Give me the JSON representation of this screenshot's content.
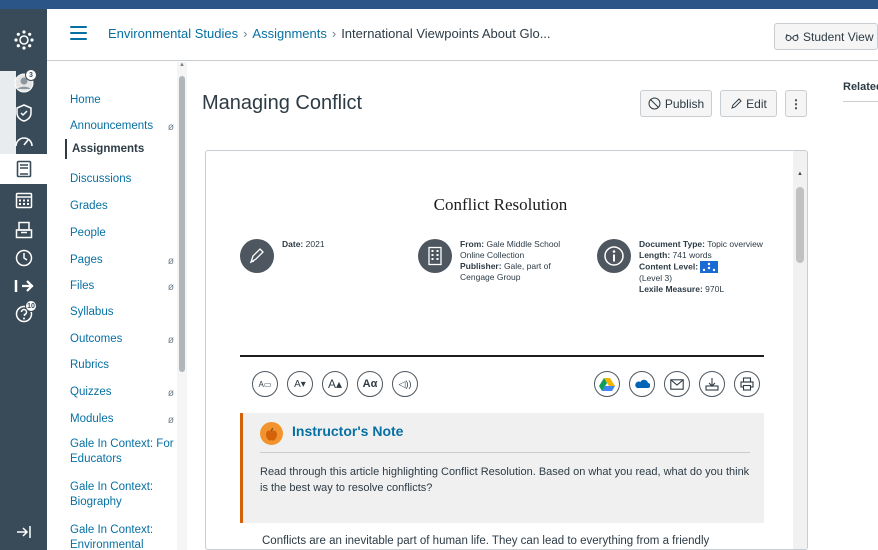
{
  "header": {
    "breadcrumbs": [
      "Environmental Studies",
      "Assignments",
      "International Viewpoints About Glo..."
    ],
    "student_view_label": "Student View"
  },
  "global_nav": {
    "items": [
      {
        "icon": "logo-icon"
      },
      {
        "icon": "account-icon",
        "badge": "3"
      },
      {
        "icon": "admin-icon"
      },
      {
        "icon": "dashboard-icon"
      },
      {
        "icon": "courses-icon",
        "active": true
      },
      {
        "icon": "calendar-icon"
      },
      {
        "icon": "inbox-icon"
      },
      {
        "icon": "history-icon"
      },
      {
        "icon": "commons-icon"
      },
      {
        "icon": "help-icon",
        "badge": "10"
      },
      {
        "icon": "collapse-icon"
      }
    ]
  },
  "course_nav": {
    "items": [
      {
        "label": "Home",
        "hidden": false
      },
      {
        "label": "Announcements",
        "hidden": true
      },
      {
        "label": "Assignments",
        "hidden": false,
        "active": true
      },
      {
        "label": "Discussions",
        "hidden": false
      },
      {
        "label": "Grades",
        "hidden": false
      },
      {
        "label": "People",
        "hidden": false
      },
      {
        "label": "Pages",
        "hidden": true
      },
      {
        "label": "Files",
        "hidden": true
      },
      {
        "label": "Syllabus",
        "hidden": false
      },
      {
        "label": "Outcomes",
        "hidden": true
      },
      {
        "label": "Rubrics",
        "hidden": false
      },
      {
        "label": "Quizzes",
        "hidden": true
      },
      {
        "label": "Modules",
        "hidden": true
      },
      {
        "label": "Gale In Context: For Educators",
        "hidden": false
      },
      {
        "label": "Gale In Context: Biography",
        "hidden": false
      },
      {
        "label": "Gale In Context: Environmental Studies",
        "hidden": false
      }
    ]
  },
  "page": {
    "title": "Managing Conflict",
    "publish_label": "Publish",
    "edit_label": "Edit",
    "related_label": "Related"
  },
  "document": {
    "title": "Conflict Resolution",
    "date_label": "Date:",
    "date_value": "2021",
    "from_label": "From:",
    "from_value": "Gale Middle School Online Collection",
    "publisher_label": "Publisher:",
    "publisher_value": "Gale, part of Cengage Group",
    "doctype_label": "Document Type:",
    "doctype_value": "Topic overview",
    "length_label": "Length:",
    "length_value": "741 words",
    "content_level_label": "Content Level:",
    "content_level_value": "(Level 3)",
    "lexile_label": "Lexile Measure:",
    "lexile_value": "970L",
    "toolbar": [
      "A▭",
      "A▾",
      "A▴",
      "Aα",
      "◁))"
    ],
    "note_title": "Instructor's Note",
    "note_text": "Read through this article highlighting Conflict Resolution. Based on what you read, what do you think is the best way to resolve conflicts?",
    "body_text": "Conflicts are an inevitable part of human life. They can lead to everything from a friendly"
  },
  "colors": {
    "accent": "#0770a3",
    "nav_bg": "#394b58",
    "note_border": "#d3620b"
  }
}
